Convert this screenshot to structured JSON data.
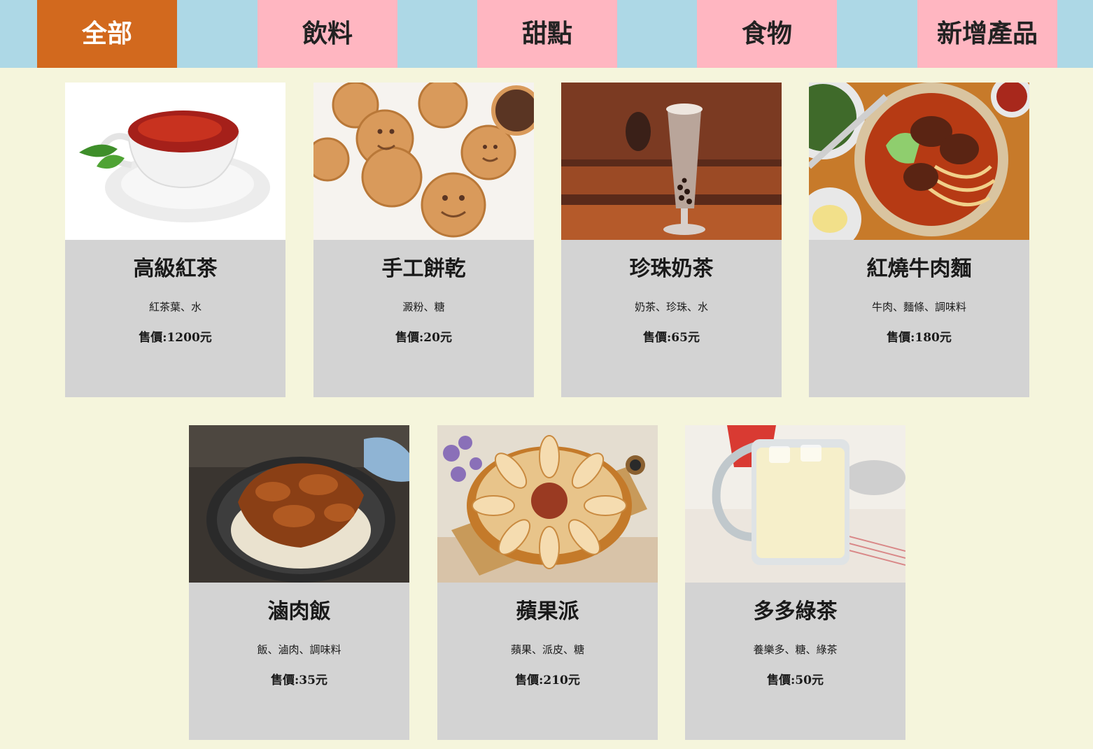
{
  "nav": {
    "tabs": [
      {
        "label": "全部",
        "active": true
      },
      {
        "label": "飲料",
        "active": false
      },
      {
        "label": "甜點",
        "active": false
      },
      {
        "label": "食物",
        "active": false
      },
      {
        "label": "新增產品",
        "active": false
      }
    ]
  },
  "products": [
    {
      "name": "高級紅茶",
      "ingredients": "紅茶葉、水",
      "price": "售價:1200元",
      "image": "black-tea-cup"
    },
    {
      "name": "手工餅乾",
      "ingredients": "澱粉、糖",
      "price": "售價:20元",
      "image": "smiley-cookies"
    },
    {
      "name": "珍珠奶茶",
      "ingredients": "奶茶、珍珠、水",
      "price": "售價:65元",
      "image": "bubble-milk-tea"
    },
    {
      "name": "紅燒牛肉麵",
      "ingredients": "牛肉、麵條、調味料",
      "price": "售價:180元",
      "image": "beef-noodle-soup"
    },
    {
      "name": "滷肉飯",
      "ingredients": "飯、滷肉、調味料",
      "price": "售價:35元",
      "image": "braised-pork-rice"
    },
    {
      "name": "蘋果派",
      "ingredients": "蘋果、派皮、糖",
      "price": "售價:210元",
      "image": "apple-pie"
    },
    {
      "name": "多多綠茶",
      "ingredients": "養樂多、糖、綠茶",
      "price": "售價:50元",
      "image": "yakult-green-tea"
    }
  ],
  "colors": {
    "page_background": "#f5f5dc",
    "nav_background": "#add8e6",
    "tab_background": "#ffb6c1",
    "active_tab_background": "#d2691e",
    "card_background": "#d3d3d3"
  }
}
